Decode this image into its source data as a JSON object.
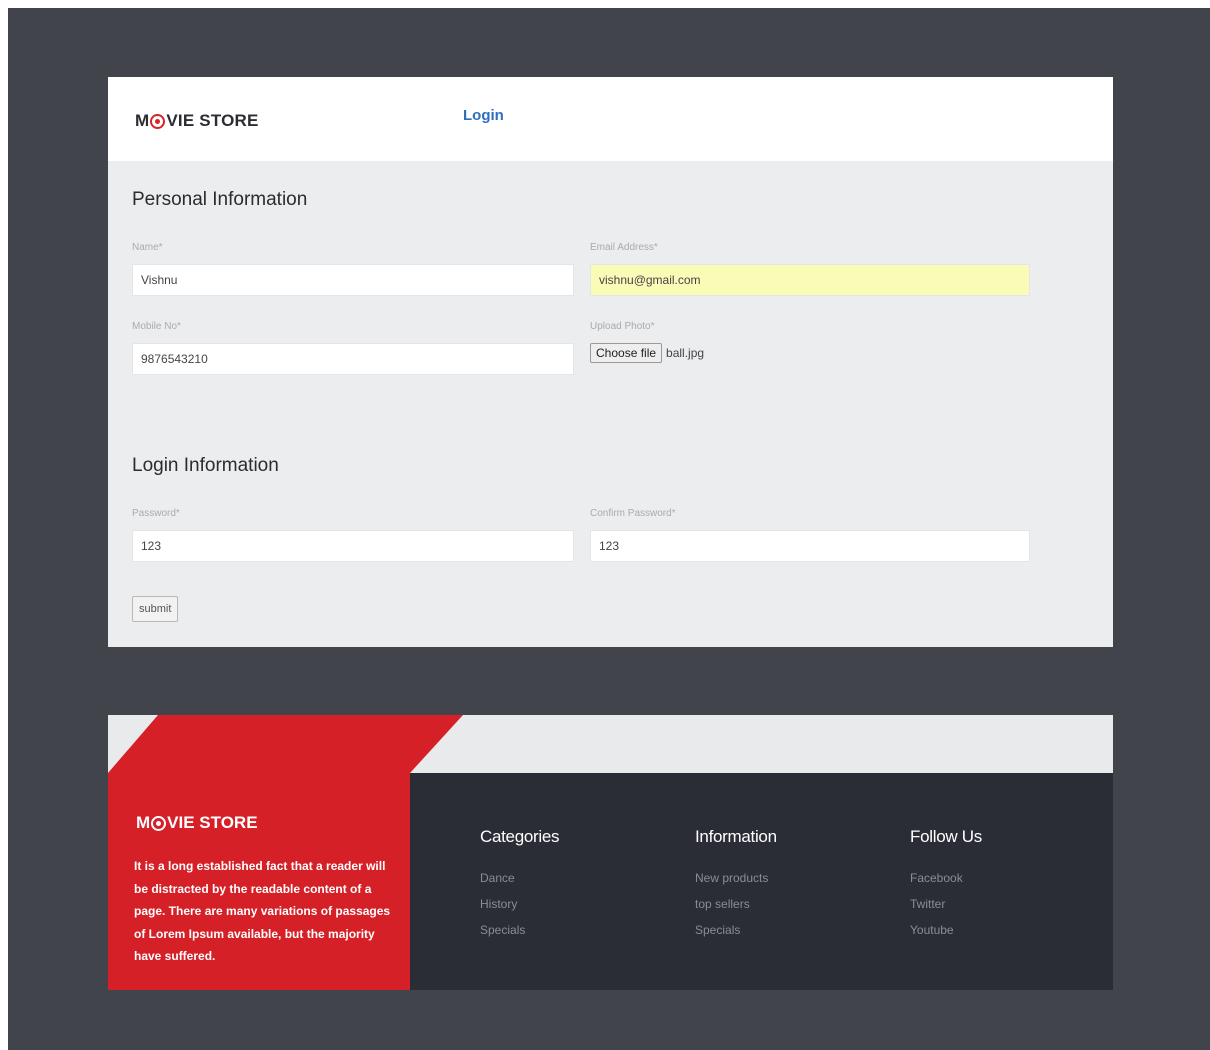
{
  "brand": {
    "name_before": "M",
    "name_after": "VIE STORE"
  },
  "nav": {
    "login": "Login"
  },
  "personal": {
    "title": "Personal Information",
    "name_label": "Name*",
    "name_value": "Vishnu",
    "email_label": "Email Address*",
    "email_value": "vishnu@gmail.com",
    "mobile_label": "Mobile No*",
    "mobile_value": "9876543210",
    "photo_label": "Upload Photo*",
    "choose_file": "Choose file",
    "file_name": "ball.jpg"
  },
  "login_info": {
    "title": "Login Information",
    "password_label": "Password*",
    "password_value": "123",
    "confirm_label": "Confirm Password*",
    "confirm_value": "123",
    "submit": "submit"
  },
  "footer": {
    "brand_before": "M",
    "brand_after": "VIE STORE",
    "about": "It is a long established fact that a reader will be distracted by the readable content of a page. There are many variations of passages of Lorem Ipsum available, but the majority have suffered.",
    "categories": {
      "title": "Categories",
      "items": [
        "Dance",
        "History",
        "Specials"
      ]
    },
    "information": {
      "title": "Information",
      "items": [
        "New products",
        "top sellers",
        "Specials"
      ]
    },
    "follow": {
      "title": "Follow Us",
      "items": [
        "Facebook",
        "Twitter",
        "Youtube"
      ]
    }
  },
  "colors": {
    "accent_red": "#d62027",
    "link_blue": "#2e6fbd",
    "dark": "#2a2c36",
    "frame": "#41444b",
    "autofill": "#fbfbb8"
  }
}
